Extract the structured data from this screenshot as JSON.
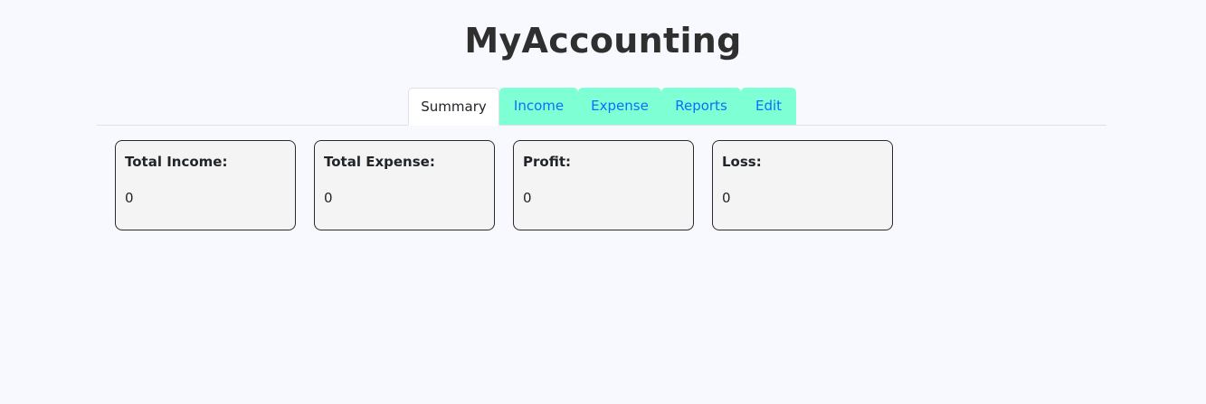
{
  "app": {
    "title": "MyAccounting"
  },
  "tabs": [
    {
      "label": "Summary",
      "active": true
    },
    {
      "label": "Income",
      "active": false
    },
    {
      "label": "Expense",
      "active": false
    },
    {
      "label": "Reports",
      "active": false
    },
    {
      "label": "Edit",
      "active": false
    }
  ],
  "summary": {
    "cards": [
      {
        "label": "Total Income:",
        "value": "0"
      },
      {
        "label": "Total Expense:",
        "value": "0"
      },
      {
        "label": "Profit:",
        "value": "0"
      },
      {
        "label": "Loss:",
        "value": "0"
      }
    ]
  },
  "colors": {
    "background": "#f8f9fe",
    "tab_inactive_bg": "#7fffd4",
    "tab_inactive_text": "#0d6efd",
    "card_bg": "#f4f4f4",
    "card_border": "#2b2b2b"
  }
}
